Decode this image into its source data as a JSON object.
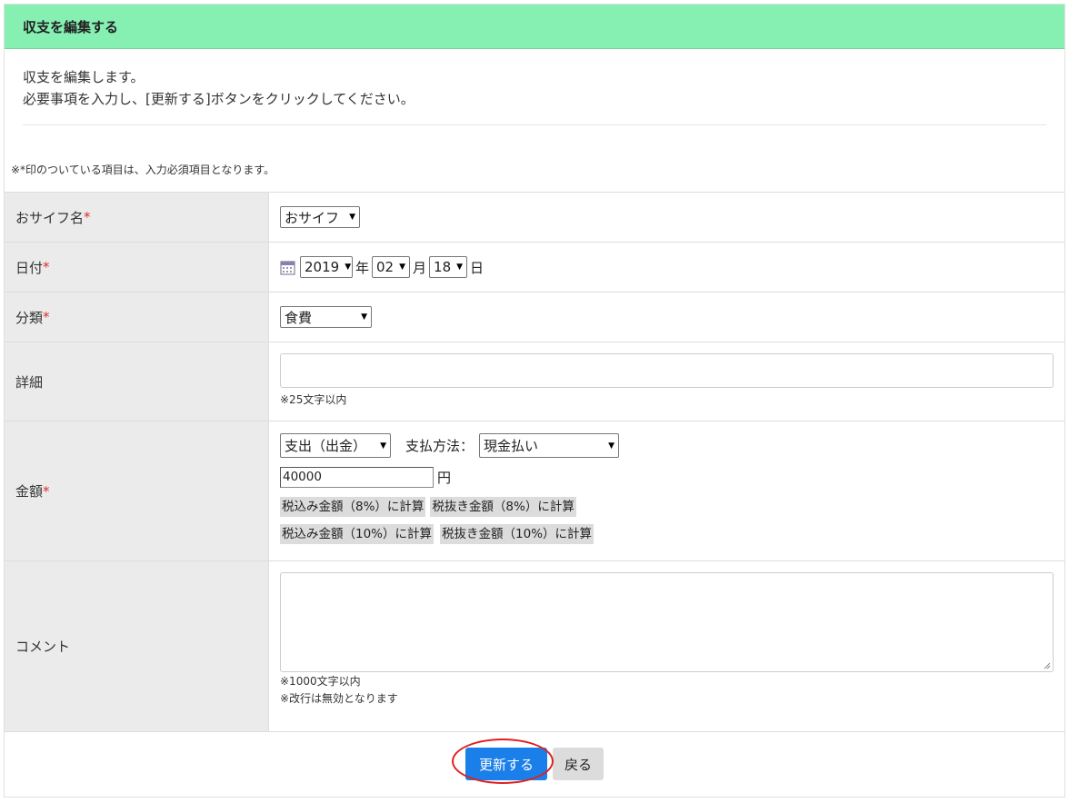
{
  "header": {
    "title": "収支を編集する"
  },
  "intro": {
    "line1": "収支を編集します。",
    "line2": "必要事項を入力し、[更新する]ボタンをクリックしてください。"
  },
  "required_note": "※*印のついている項目は、入力必須項目となります。",
  "required_mark": "*",
  "fields": {
    "wallet": {
      "label": "おサイフ名",
      "value": "おサイフ"
    },
    "date": {
      "label": "日付",
      "year": "2019",
      "year_unit": "年",
      "month": "02",
      "month_unit": "月",
      "day": "18",
      "day_unit": "日"
    },
    "category": {
      "label": "分類",
      "value": "食費"
    },
    "detail": {
      "label": "詳細",
      "value": "",
      "hint": "※25文字以内"
    },
    "amount": {
      "label": "金額",
      "type": "支出（出金）",
      "payment_label": "支払方法：",
      "payment_method": "現金払い",
      "value": "40000",
      "unit": "円",
      "calc_buttons": [
        "税込み金額（8%）に計算",
        "税抜き金額（8%）に計算",
        "税込み金額（10%）に計算",
        "税抜き金額（10%）に計算"
      ]
    },
    "comment": {
      "label": "コメント",
      "value": "",
      "hint1": "※1000文字以内",
      "hint2": "※改行は無効となります"
    }
  },
  "buttons": {
    "update": "更新する",
    "back": "戻る"
  },
  "colors": {
    "header_bg": "#86f0b3",
    "primary": "#1a7fe8",
    "required": "#d9302c",
    "highlight": "#e02020"
  }
}
